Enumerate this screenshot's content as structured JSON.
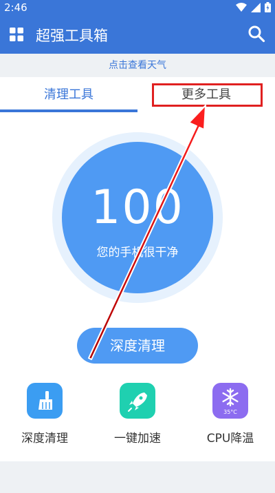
{
  "status": {
    "time": "2:46"
  },
  "header": {
    "title": "超强工具箱"
  },
  "weather": {
    "text": "点击查看天气"
  },
  "tabs": [
    {
      "label": "清理工具"
    },
    {
      "label": "更多工具"
    }
  ],
  "score": {
    "value": "100",
    "caption": "您的手机很干净"
  },
  "action": {
    "deep_clean_label": "深度清理"
  },
  "tools": [
    {
      "label": "深度清理",
      "icon": "broom-icon"
    },
    {
      "label": "一键加速",
      "icon": "rocket-icon"
    },
    {
      "label": "CPU降温",
      "icon": "snowflake-icon",
      "badge": "35°C"
    }
  ],
  "colors": {
    "primary": "#3a76d8",
    "circle": "#4f9af3",
    "highlight": "#e02020",
    "broom": "#3b9df2",
    "rocket": "#1fd0b0",
    "snowflake": "#8c6cf0"
  }
}
